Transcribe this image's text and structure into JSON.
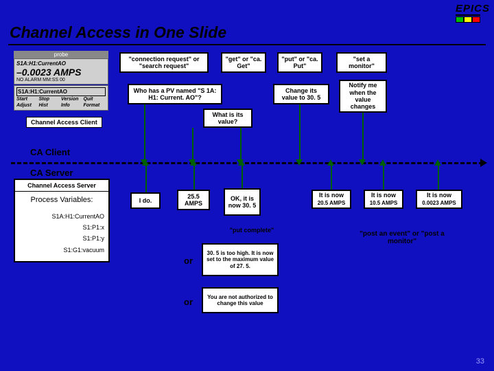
{
  "logo_text": "EPICS",
  "title": "Channel Access in One Slide",
  "widget": {
    "title": "probe",
    "pv1": "S1A:H1:CurrentAO",
    "value": "–0.0023 AMPS",
    "alarm": "NO ALARM  MM:SS 00",
    "pv2": "S1A:H1:CurrentAO",
    "btns": [
      "Start",
      "Stop",
      "Version",
      "Quit",
      "Adjust",
      "Hist",
      "Info",
      "Format"
    ]
  },
  "client_caption": "Channel Access Client",
  "top": {
    "conn": "\"connection request\" or \"search request\"",
    "get": "\"get\" or \"ca. Get\"",
    "put": "\"put\" or \"ca. Put\"",
    "mon": "\"set a monitor\""
  },
  "mid": {
    "who": "Who has a PV named \"S 1A: H1: Current. AO\"?",
    "what": "What is its value?",
    "change": "Change its value to 30. 5",
    "notify": "Notify me when the value changes"
  },
  "zone_client": "CA Client",
  "zone_server": "CA Server",
  "server": {
    "caption": "Channel Access Server",
    "pv_label": "Process Variables:",
    "pvs": [
      "S1A:H1:CurrentAO",
      "S1:P1:x",
      "S1:P1:y",
      "S1:G1:vacuum"
    ]
  },
  "ans": {
    "ido": "I do.",
    "amps": "25.5 AMPS",
    "ok": "OK, it is now 30. 5",
    "now1": "It is now",
    "now1v": "20.5 AMPS",
    "now2": "It is now",
    "now2v": "10.5 AMPS",
    "now3": "It is now",
    "now3v": "0.0023 AMPS"
  },
  "putcomplete": "\"put complete\"",
  "postevent": "\"post an event\" or \"post a monitor\"",
  "or": "or",
  "resp1": "30. 5 is too high. It is now set to the maximum value of 27. 5.",
  "resp2": "You are not authorized to change this value",
  "pagenum": "33"
}
